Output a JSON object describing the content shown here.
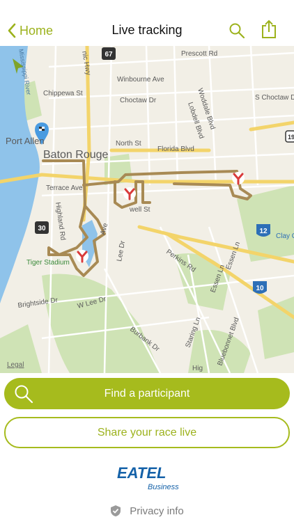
{
  "nav": {
    "back_label": "Home",
    "title": "Live tracking"
  },
  "map": {
    "places": {
      "port_allen": "Port Allen",
      "baton_rouge": "Baton Rouge",
      "tiger_stadium": "Tiger Stadium",
      "river": "Mississippi River"
    },
    "streets": {
      "prescott": "Prescott Rd",
      "winbourne": "Winbourne Ave",
      "choctaw_dr": "Choctaw Dr",
      "chippewa": "Chippewa St",
      "north": "North St",
      "florida": "Florida Blvd",
      "terrace": "Terrace Ave",
      "howell": "well St",
      "highland": "Highland Rd",
      "perkins": "Perkins Rd",
      "lee_dr": "Lee Dr",
      "w_lee": "W Lee Dr",
      "brightside": "Brightside Dr",
      "burbank": "Burbank Dr",
      "staring": "Staring Ln",
      "essen": "Essen Ln",
      "essen2": "Essen Ln",
      "bluebonnet": "Bluebonnet Blvd",
      "woddale": "Woddale Blvd",
      "lobdell": "Lobdell Blvd",
      "s_choctaw": "S Choctaw Dr",
      "clay_cut": "Clay Cu",
      "hwy": "nic Hwy",
      "ave": "Ave",
      "hig": "Hig"
    },
    "shields": {
      "us67": "67",
      "us30": "30",
      "i12": "12",
      "i10": "10",
      "us19": "19"
    },
    "legal": "Legal"
  },
  "actions": {
    "find_label": "Find a participant",
    "share_label": "Share your race live"
  },
  "branding": {
    "logo_main": "EATEL",
    "logo_sub": "Business"
  },
  "footer": {
    "privacy_label": "Privacy info"
  },
  "colors": {
    "accent": "#a6bb1d",
    "route": "#a88a54",
    "marker": "#d93b3b",
    "water": "#8fc3ea",
    "logo": "#1461a8"
  }
}
